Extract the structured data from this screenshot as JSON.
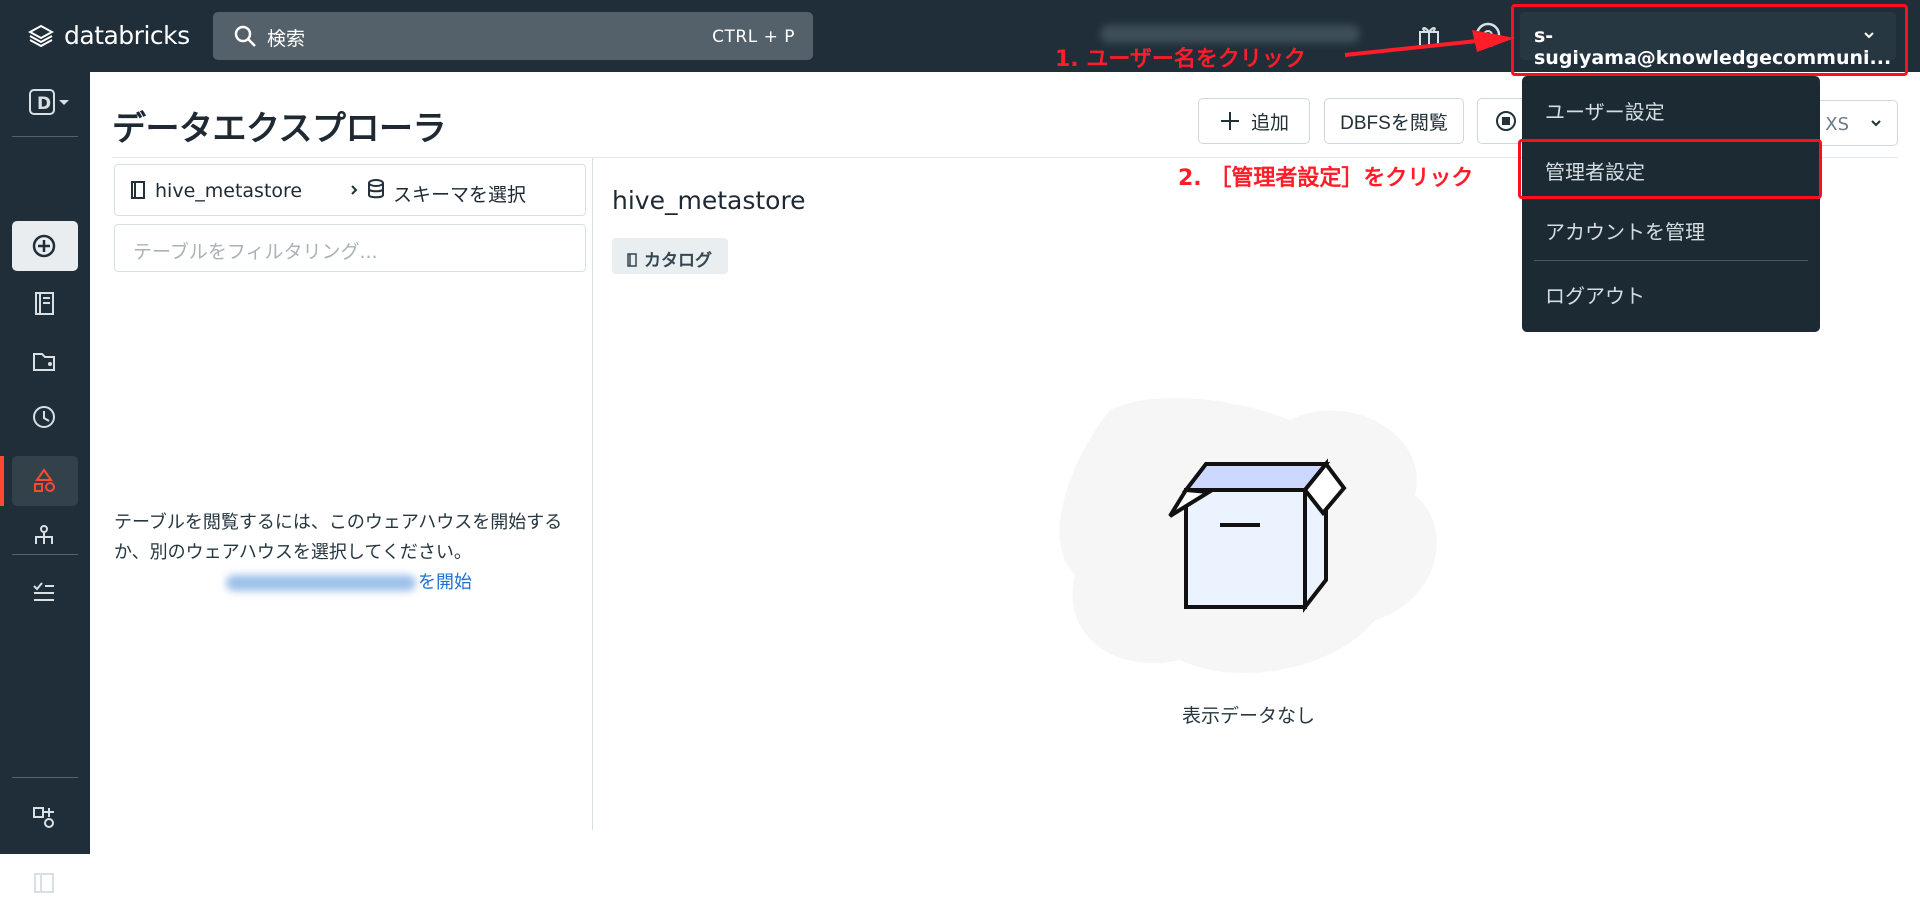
{
  "app": {
    "brand": "databricks"
  },
  "topbar": {
    "search_placeholder": "検索",
    "search_shortcut": "CTRL + P",
    "user_email": "s-sugiyama@knowledgecommuni..."
  },
  "annotations": {
    "step1": "1. ユーザー名をクリック",
    "step2": "2. ［管理者設定］をクリック"
  },
  "page": {
    "title": "データエクスプローラ"
  },
  "toolbar": {
    "add_label": "追加",
    "dbfs_label": "DBFSを閲覧",
    "size_label": "XS"
  },
  "explorer": {
    "catalog": "hive_metastore",
    "schema_placeholder": "スキーマを選択",
    "filter_placeholder": "テーブルをフィルタリング...",
    "message": "テーブルを閲覧するには、このウェアハウスを開始するか、別のウェアハウスを選択してください。",
    "start_link": "を開始"
  },
  "details": {
    "name": "hive_metastore",
    "badge": "カタログ",
    "empty_text": "表示データなし"
  },
  "user_menu": {
    "items": [
      "ユーザー設定",
      "管理者設定",
      "アカウントを管理",
      "ログアウト"
    ]
  },
  "icons": [
    "databricks-logo-icon",
    "search-icon",
    "gift-icon",
    "help-icon",
    "chevron-down-icon",
    "workspace-icon",
    "new-icon",
    "notebook-icon",
    "repos-icon",
    "history-icon",
    "data-icon",
    "workflow-icon",
    "tasks-icon",
    "partners-icon",
    "sidebar-toggle-icon",
    "catalog-icon",
    "schema-icon",
    "box-icon"
  ],
  "colors": {
    "nav": "#1f2e38",
    "annotation": "#ff1d29",
    "active": "#ff4a2f"
  }
}
